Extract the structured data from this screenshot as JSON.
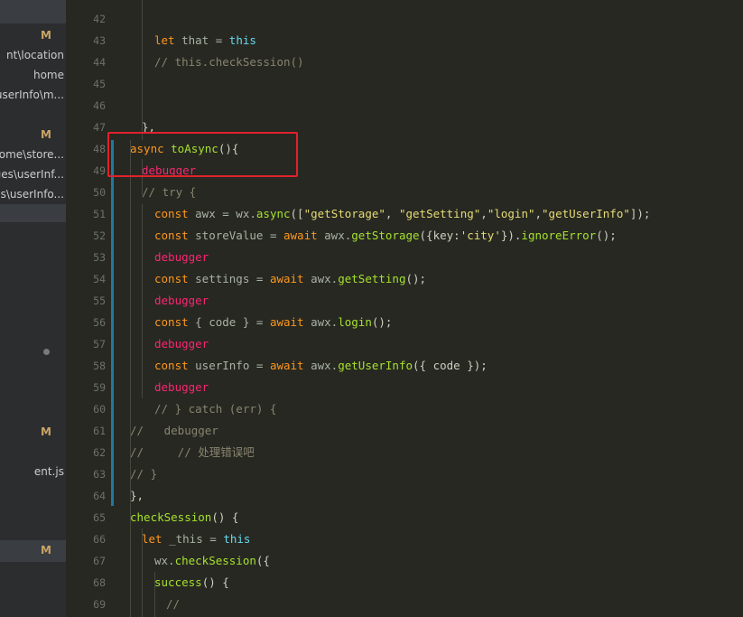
{
  "sidebar": {
    "items": [
      {
        "text": "",
        "badge": "M"
      },
      {
        "text": "nt\\location",
        "badge": ""
      },
      {
        "text": "home",
        "badge": ""
      },
      {
        "text": "\\userInfo\\m...",
        "badge": ""
      },
      {
        "text": "",
        "badge": "M"
      },
      {
        "text": "home\\store...",
        "badge": ""
      },
      {
        "text": "ges\\userInf...",
        "badge": ""
      },
      {
        "text": "ges\\userInfo...",
        "badge": ""
      },
      {
        "text": "",
        "badge": "M"
      },
      {
        "text": "ent.js",
        "badge": ""
      },
      {
        "text": "",
        "badge": "M"
      }
    ]
  },
  "editor": {
    "lines": [
      {
        "n": "42",
        "tokens": []
      },
      {
        "n": "43",
        "tokens": [
          {
            "t": "let",
            "c": "kw"
          },
          {
            "t": " that = ",
            "c": "var"
          },
          {
            "t": "this",
            "c": "this"
          }
        ]
      },
      {
        "n": "44",
        "tokens": [
          {
            "t": "// this.checkSession()",
            "c": "com"
          }
        ]
      },
      {
        "n": "45",
        "tokens": []
      },
      {
        "n": "46",
        "tokens": []
      },
      {
        "n": "47",
        "tokens": [
          {
            "t": "},",
            "c": "punc"
          }
        ]
      },
      {
        "n": "48",
        "tokens": [
          {
            "t": "async ",
            "c": "kw"
          },
          {
            "t": "toAsync",
            "c": "fn"
          },
          {
            "t": "(){",
            "c": "punc"
          }
        ]
      },
      {
        "n": "49",
        "tokens": [
          {
            "t": "debugger",
            "c": "dbg"
          }
        ]
      },
      {
        "n": "50",
        "tokens": [
          {
            "t": "// try {",
            "c": "com"
          }
        ]
      },
      {
        "n": "51",
        "tokens": [
          {
            "t": "const ",
            "c": "kw"
          },
          {
            "t": "awx = wx.",
            "c": "var"
          },
          {
            "t": "async",
            "c": "fn"
          },
          {
            "t": "([",
            "c": "punc"
          },
          {
            "t": "\"getStorage\"",
            "c": "str"
          },
          {
            "t": ", ",
            "c": "punc"
          },
          {
            "t": "\"getSetting\"",
            "c": "str"
          },
          {
            "t": ",",
            "c": "punc"
          },
          {
            "t": "\"login\"",
            "c": "str"
          },
          {
            "t": ",",
            "c": "punc"
          },
          {
            "t": "\"getUserInfo\"",
            "c": "str"
          },
          {
            "t": "]);",
            "c": "punc"
          }
        ]
      },
      {
        "n": "52",
        "tokens": [
          {
            "t": "const ",
            "c": "kw"
          },
          {
            "t": "storeValue = ",
            "c": "var"
          },
          {
            "t": "await ",
            "c": "kw"
          },
          {
            "t": "awx.",
            "c": "var"
          },
          {
            "t": "getStorage",
            "c": "fn"
          },
          {
            "t": "({key:",
            "c": "punc"
          },
          {
            "t": "'city'",
            "c": "str"
          },
          {
            "t": "}).",
            "c": "punc"
          },
          {
            "t": "ignoreError",
            "c": "fn"
          },
          {
            "t": "();",
            "c": "punc"
          }
        ]
      },
      {
        "n": "53",
        "tokens": [
          {
            "t": "debugger",
            "c": "dbg"
          }
        ]
      },
      {
        "n": "54",
        "tokens": [
          {
            "t": "const ",
            "c": "kw"
          },
          {
            "t": "settings = ",
            "c": "var"
          },
          {
            "t": "await ",
            "c": "kw"
          },
          {
            "t": "awx.",
            "c": "var"
          },
          {
            "t": "getSetting",
            "c": "fn"
          },
          {
            "t": "();",
            "c": "punc"
          }
        ]
      },
      {
        "n": "55",
        "tokens": [
          {
            "t": "debugger",
            "c": "dbg"
          }
        ]
      },
      {
        "n": "56",
        "tokens": [
          {
            "t": "const ",
            "c": "kw"
          },
          {
            "t": "{ code } = ",
            "c": "var"
          },
          {
            "t": "await ",
            "c": "kw"
          },
          {
            "t": "awx.",
            "c": "var"
          },
          {
            "t": "login",
            "c": "fn"
          },
          {
            "t": "();",
            "c": "punc"
          }
        ]
      },
      {
        "n": "57",
        "tokens": [
          {
            "t": "debugger",
            "c": "dbg"
          }
        ]
      },
      {
        "n": "58",
        "tokens": [
          {
            "t": "const ",
            "c": "kw"
          },
          {
            "t": "userInfo = ",
            "c": "var"
          },
          {
            "t": "await ",
            "c": "kw"
          },
          {
            "t": "awx.",
            "c": "var"
          },
          {
            "t": "getUserInfo",
            "c": "fn"
          },
          {
            "t": "({ code });",
            "c": "punc"
          }
        ]
      },
      {
        "n": "59",
        "tokens": [
          {
            "t": "debugger",
            "c": "dbg"
          }
        ]
      },
      {
        "n": "60",
        "tokens": [
          {
            "t": "// } catch (err) {",
            "c": "com"
          }
        ]
      },
      {
        "n": "61",
        "tokens": [
          {
            "t": "//   debugger",
            "c": "com"
          }
        ]
      },
      {
        "n": "62",
        "tokens": [
          {
            "t": "//     // 处理错误吧",
            "c": "com"
          }
        ]
      },
      {
        "n": "63",
        "tokens": [
          {
            "t": "// }",
            "c": "com"
          }
        ]
      },
      {
        "n": "64",
        "tokens": [
          {
            "t": "},",
            "c": "punc"
          }
        ]
      },
      {
        "n": "65",
        "tokens": [
          {
            "t": "checkSession",
            "c": "fn"
          },
          {
            "t": "() {",
            "c": "punc"
          }
        ]
      },
      {
        "n": "66",
        "tokens": [
          {
            "t": "let ",
            "c": "kw"
          },
          {
            "t": "_this = ",
            "c": "var"
          },
          {
            "t": "this",
            "c": "this"
          }
        ]
      },
      {
        "n": "67",
        "tokens": [
          {
            "t": "wx.",
            "c": "var"
          },
          {
            "t": "checkSession",
            "c": "fn"
          },
          {
            "t": "({",
            "c": "punc"
          }
        ]
      },
      {
        "n": "68",
        "tokens": [
          {
            "t": "success",
            "c": "fn"
          },
          {
            "t": "() {",
            "c": "punc"
          }
        ]
      },
      {
        "n": "69",
        "tokens": [
          {
            "t": "//",
            "c": "com"
          }
        ]
      }
    ]
  }
}
